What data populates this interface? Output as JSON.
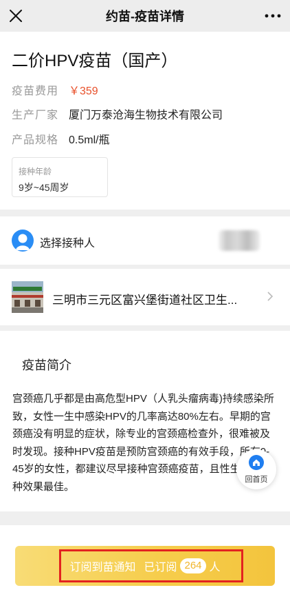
{
  "topbar": {
    "title": "约苗-疫苗详情"
  },
  "vaccine": {
    "title": "二价HPV疫苗（国产）",
    "fee_label": "疫苗费用",
    "fee_value": "￥359",
    "maker_label": "生产厂家",
    "maker_value": "厦门万泰沧海生物技术有限公司",
    "spec_label": "产品规格",
    "spec_value": "0.5ml/瓶",
    "age_label": "接种年龄",
    "age_value": "9岁~45周岁"
  },
  "person": {
    "label": "选择接种人"
  },
  "clinic": {
    "name": "三明市三元区富兴堡街道社区卫生..."
  },
  "intro": {
    "heading": "疫苗简介",
    "body": "宫颈癌几乎都是由高危型HPV（人乳头瘤病毒)持续感染所致，女性一生中感染HPV的几率高达80%左右。早期的宫颈癌没有明显的症状，除专业的宫颈癌检查外，很难被及时发现。接种HPV疫苗是预防宫颈癌的有效手段，所有9-45岁的女性，都建议尽早接种宫颈癌疫苗，且性生活前接种效果最佳。"
  },
  "home_float": {
    "label": "回首页"
  },
  "subscribe": {
    "label": "订阅到苗通知",
    "subscribed_prefix": "已订阅",
    "count": "264",
    "suffix": "人"
  },
  "colors": {
    "price": "#e8502a",
    "button": "#f6cd4c",
    "highlight": "#e3221f",
    "avatar": "#2a8df5"
  }
}
